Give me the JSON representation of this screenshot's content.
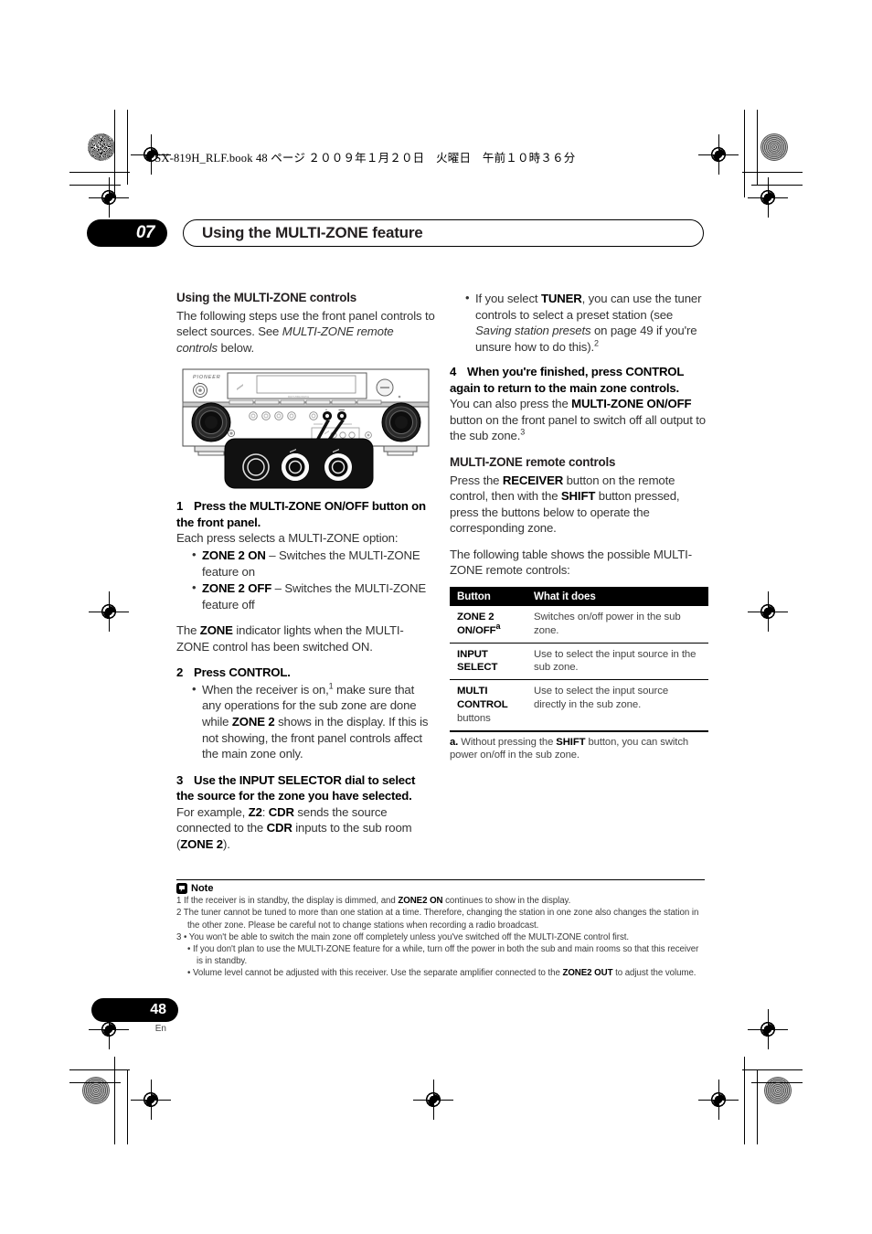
{
  "file_header": "VSX-819H_RLF.book   48 ページ   ２００９年１月２０日　火曜日　午前１０時３６分",
  "chapter": {
    "number": "07",
    "title": "Using the MULTI-ZONE feature"
  },
  "left_column": {
    "heading": "Using the MULTI-ZONE controls",
    "intro_1": "The following steps use the front panel controls to select sources. See ",
    "intro_italic": "MULTI-ZONE remote controls",
    "intro_2": " below.",
    "illustration_name": "av-receiver-front-panel",
    "step1": {
      "num": "1",
      "title": "Press the MULTI-ZONE ON/OFF button on the front panel.",
      "lead": "Each press selects a MULTI-ZONE option:"
    },
    "step1_bullets": [
      {
        "bold": "ZONE 2 ON",
        "rest": " – Switches the MULTI-ZONE feature on"
      },
      {
        "bold": "ZONE 2 OFF",
        "rest": " – Switches the MULTI-ZONE feature off"
      }
    ],
    "step1_after_a": "The ",
    "step1_after_b": "ZONE",
    "step1_after_c": " indicator lights when the MULTI-ZONE control has been switched ON.",
    "step2": {
      "num": "2",
      "title": "Press CONTROL."
    },
    "step2_bullet": {
      "p1": "When the receiver is on,",
      "sup": "1",
      "p2": " make sure that any operations for the sub zone are done while ",
      "bold1": "ZONE 2",
      "p3": " shows in the display. If this is not showing, the front panel controls affect the main zone only."
    },
    "step3": {
      "num": "3",
      "title": "Use the INPUT SELECTOR dial to select the source for the zone you have selected."
    },
    "step3_body": {
      "p1": "For example, ",
      "b1": "Z2",
      "p2": ": ",
      "b2": "CDR",
      "p3": " sends the source connected to the ",
      "b3": "CDR",
      "p4": " inputs to the sub room (",
      "b4": "ZONE 2",
      "p5": ")."
    }
  },
  "right_column": {
    "bullet_tuner": {
      "p1": "If you select ",
      "b1": "TUNER",
      "p2": ", you can use the tuner controls to select a preset station (see ",
      "it1": "Saving station presets",
      "p3": " on page 49 if you're unsure how to do this).",
      "sup": "2"
    },
    "step4": {
      "num": "4",
      "title": "When you're finished, press CONTROL again to return to the main zone controls."
    },
    "step4_body": {
      "p1": "You can also press the ",
      "b1": "MULTI-ZONE ON/OFF",
      "p2": " button on the front panel to switch off all output to the sub zone.",
      "sup": "3"
    },
    "remote_heading": "MULTI-ZONE remote controls",
    "remote_body": {
      "p1": "Press the ",
      "b1": "RECEIVER",
      "p2": " button on the remote control, then with the ",
      "b2": "SHIFT",
      "p3": " button pressed, press the buttons below to operate the corresponding zone."
    },
    "table_intro": "The following table shows the possible MULTI-ZONE remote controls:",
    "table": {
      "headers": [
        "Button",
        "What it does"
      ],
      "rows": [
        {
          "button": "ZONE 2 ON/OFF",
          "sup": "a",
          "sub": "",
          "what": "Switches on/off power in the sub zone."
        },
        {
          "button": "INPUT SELECT",
          "sup": "",
          "sub": "",
          "what": "Use to select the input source in the sub zone."
        },
        {
          "button": "MULTI CONTROL",
          "sup": "",
          "sub": "buttons",
          "what": "Use to select the input source directly in the sub zone."
        }
      ]
    },
    "table_footnote": {
      "label": "a.",
      "p1": " Without pressing the ",
      "b1": "SHIFT",
      "p2": " button, you can switch power on/off in the sub zone."
    }
  },
  "notes": {
    "title": "Note",
    "items": [
      {
        "num": "1",
        "p1": " If the receiver is in standby, the display is dimmed, and ",
        "b1": "ZONE2 ON",
        "p2": " continues to show in the display.",
        "sub": false
      },
      {
        "num": "2",
        "p1": " The tuner cannot be tuned to more than one station at a time. Therefore, changing the station in one zone also changes the station in the other zone. Please be careful not to change stations when recording a radio broadcast.",
        "b1": "",
        "p2": "",
        "sub": false
      },
      {
        "num": "3",
        "p1": " • You won't be able to switch the main zone off completely unless you've switched off the MULTI-ZONE control first.",
        "b1": "",
        "p2": "",
        "sub": false
      },
      {
        "num": "",
        "p1": "• If you don't plan to use the MULTI-ZONE feature for a while, turn off the power in both the sub and main rooms so that this receiver is in standby.",
        "b1": "",
        "p2": "",
        "sub": true
      },
      {
        "num": "",
        "p1": "• Volume level cannot be adjusted with this receiver. Use the separate amplifier connected to the ",
        "b1": "ZONE2 OUT",
        "p2": " to adjust the volume.",
        "sub": true
      }
    ]
  },
  "footer": {
    "page_number": "48",
    "language": "En"
  },
  "colors": {
    "ink": "#231f20",
    "black": "#000000",
    "body_gray": "#333333"
  }
}
